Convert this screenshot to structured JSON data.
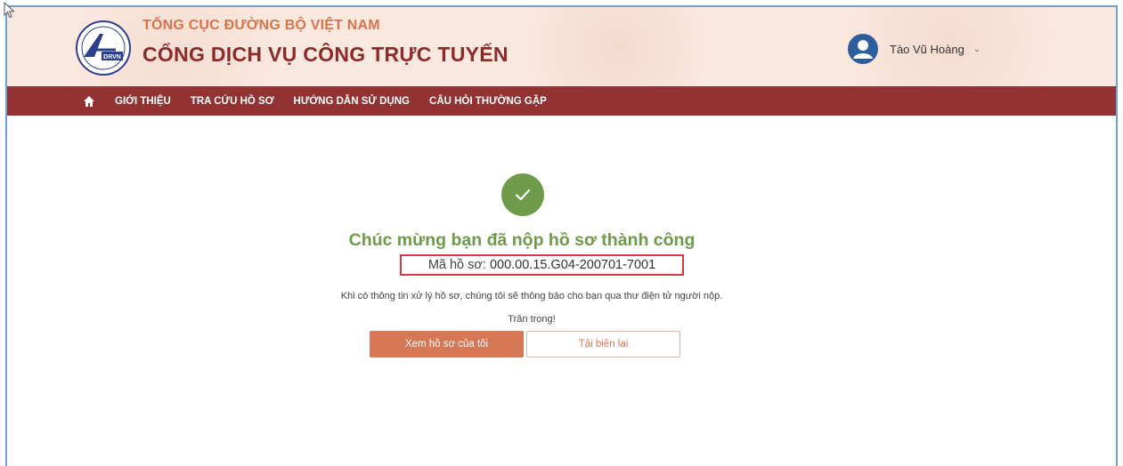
{
  "header": {
    "logo_text": "DRVN",
    "org_name": "TỔNG CỤC ĐƯỜNG BỘ VIỆT NAM",
    "portal_name": "CỔNG DỊCH VỤ CÔNG TRỰC TUYẾN",
    "user": {
      "name": "Tào Vũ Hoàng",
      "avatar_icon": "user-avatar-icon",
      "caret_icon": "chevron-down-icon"
    }
  },
  "nav": {
    "home_icon": "home-icon",
    "items": [
      {
        "label": "GIỚI THIỆU"
      },
      {
        "label": "TRA CỨU HỒ SƠ"
      },
      {
        "label": "HƯỚNG DẪN SỬ DỤNG"
      },
      {
        "label": "CÂU HỎI THƯỜNG GẶP"
      }
    ]
  },
  "main": {
    "success_icon": "check-icon",
    "title": "Chúc mừng bạn đã nộp hồ sơ thành công",
    "record_label": "Mã hồ sơ:",
    "record_code": "000.00.15.G04-200701-7001",
    "notice": "Khi có thông tin xử lý hồ sơ, chúng tôi sẽ thông báo cho bạn qua thư điện tử người nộp.",
    "regards": "Trân trọng!",
    "buttons": {
      "view": "Xem hồ sơ của tôi",
      "download": "Tải biên lai"
    }
  },
  "colors": {
    "brand_dark_red": "#923232",
    "brand_orange": "#d9734a",
    "success_green": "#6f9a4a",
    "highlight_red": "#d9383a",
    "button_orange": "#d67756"
  }
}
